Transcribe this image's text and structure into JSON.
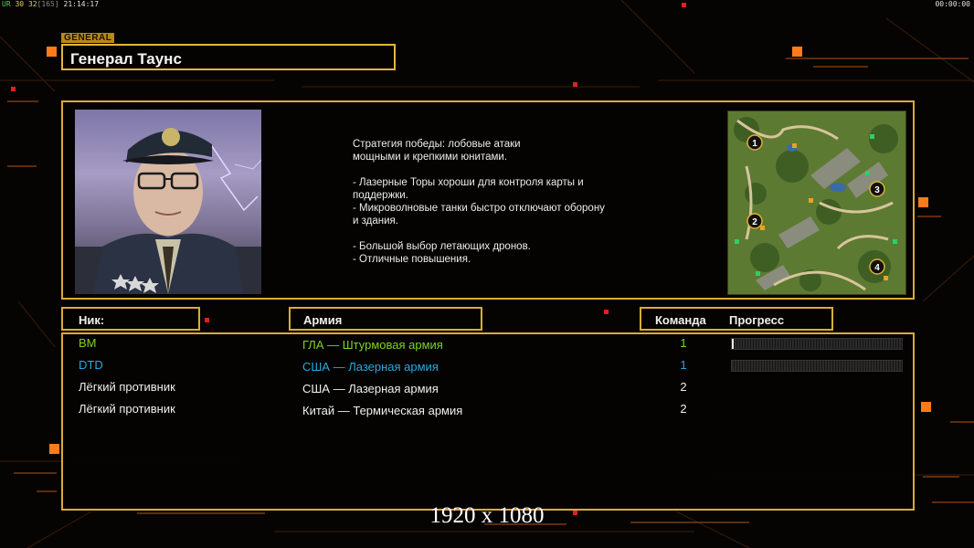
{
  "hud": {
    "fps_label": "UR",
    "fps_a": "30",
    "fps_b": "32",
    "fps_c": "[165]",
    "clock": "21:14:17",
    "timer": "00:00:00"
  },
  "general": {
    "tag": "GENERAL",
    "name": "Генерал Таунс",
    "portrait_icon": "general-portrait",
    "description": "Стратегия победы: лобовые атаки\nмощными и крепкими юнитами.\n\n- Лазерные Торы хороши для контроля карты и\n  поддержки.\n- Микроволновые танки быстро отключают оборону\n  и здания.\n\n- Большой выбор летающих дронов.\n- Отличные повышения."
  },
  "minimap": {
    "icon": "map-preview",
    "start_positions": [
      "1",
      "2",
      "3",
      "4"
    ]
  },
  "table": {
    "headers": {
      "nick": "Ник:",
      "army": "Армия",
      "team": "Команда",
      "progress": "Прогресс"
    },
    "rows": [
      {
        "nick": "BM",
        "army": "ГЛА — Штурмовая армия",
        "team": "1",
        "progress": 0.01,
        "nick_color": "#7ed321",
        "army_color": "#7ed321",
        "team_color": "#7ed321"
      },
      {
        "nick": "DTD",
        "army": "США — Лазерная армия",
        "team": "1",
        "progress": 0,
        "nick_color": "#2aa8e0",
        "army_color": "#2aa8e0",
        "team_color": "#2aa8e0"
      },
      {
        "nick": "Лёгкий противник",
        "army": "США — Лазерная армия",
        "team": "2",
        "nick_color": "#f0f0f0",
        "army_color": "#f0f0f0",
        "team_color": "#f0f0f0"
      },
      {
        "nick": "Лёгкий противник",
        "army": "Китай — Термическая армия",
        "team": "2",
        "nick_color": "#f0f0f0",
        "army_color": "#f0f0f0",
        "team_color": "#f0f0f0"
      }
    ]
  },
  "resolution_label": "1920 x 1080",
  "colors": {
    "accent": "#d8ad35",
    "orange": "#ff7a1a",
    "red": "#e02020"
  }
}
